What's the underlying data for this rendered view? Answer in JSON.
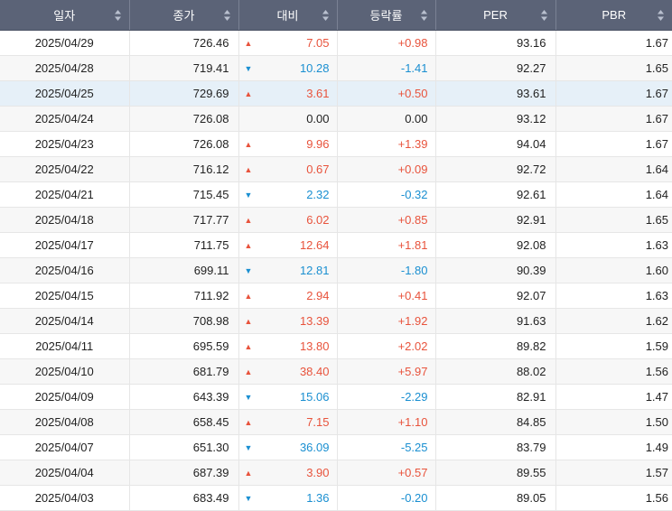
{
  "headers": {
    "date": "일자",
    "close": "종가",
    "diff": "대비",
    "rate": "등락률",
    "per": "PER",
    "pbr": "PBR"
  },
  "colors": {
    "up": "#e8533c",
    "down": "#1a8fd1",
    "header_bg": "#5b6377",
    "highlight_row": "#e6f0f8"
  },
  "icons": {
    "sort": "sort-updown-icon",
    "up": "triangle-up-icon",
    "down": "triangle-down-icon"
  },
  "highlighted_row": 2,
  "rows": [
    {
      "date": "2025/04/29",
      "close": "726.46",
      "dir": "up",
      "diff": "7.05",
      "rate": "+0.98",
      "per": "93.16",
      "pbr": "1.67"
    },
    {
      "date": "2025/04/28",
      "close": "719.41",
      "dir": "down",
      "diff": "10.28",
      "rate": "-1.41",
      "per": "92.27",
      "pbr": "1.65"
    },
    {
      "date": "2025/04/25",
      "close": "729.69",
      "dir": "up",
      "diff": "3.61",
      "rate": "+0.50",
      "per": "93.61",
      "pbr": "1.67"
    },
    {
      "date": "2025/04/24",
      "close": "726.08",
      "dir": "flat",
      "diff": "0.00",
      "rate": "0.00",
      "per": "93.12",
      "pbr": "1.67"
    },
    {
      "date": "2025/04/23",
      "close": "726.08",
      "dir": "up",
      "diff": "9.96",
      "rate": "+1.39",
      "per": "94.04",
      "pbr": "1.67"
    },
    {
      "date": "2025/04/22",
      "close": "716.12",
      "dir": "up",
      "diff": "0.67",
      "rate": "+0.09",
      "per": "92.72",
      "pbr": "1.64"
    },
    {
      "date": "2025/04/21",
      "close": "715.45",
      "dir": "down",
      "diff": "2.32",
      "rate": "-0.32",
      "per": "92.61",
      "pbr": "1.64"
    },
    {
      "date": "2025/04/18",
      "close": "717.77",
      "dir": "up",
      "diff": "6.02",
      "rate": "+0.85",
      "per": "92.91",
      "pbr": "1.65"
    },
    {
      "date": "2025/04/17",
      "close": "711.75",
      "dir": "up",
      "diff": "12.64",
      "rate": "+1.81",
      "per": "92.08",
      "pbr": "1.63"
    },
    {
      "date": "2025/04/16",
      "close": "699.11",
      "dir": "down",
      "diff": "12.81",
      "rate": "-1.80",
      "per": "90.39",
      "pbr": "1.60"
    },
    {
      "date": "2025/04/15",
      "close": "711.92",
      "dir": "up",
      "diff": "2.94",
      "rate": "+0.41",
      "per": "92.07",
      "pbr": "1.63"
    },
    {
      "date": "2025/04/14",
      "close": "708.98",
      "dir": "up",
      "diff": "13.39",
      "rate": "+1.92",
      "per": "91.63",
      "pbr": "1.62"
    },
    {
      "date": "2025/04/11",
      "close": "695.59",
      "dir": "up",
      "diff": "13.80",
      "rate": "+2.02",
      "per": "89.82",
      "pbr": "1.59"
    },
    {
      "date": "2025/04/10",
      "close": "681.79",
      "dir": "up",
      "diff": "38.40",
      "rate": "+5.97",
      "per": "88.02",
      "pbr": "1.56"
    },
    {
      "date": "2025/04/09",
      "close": "643.39",
      "dir": "down",
      "diff": "15.06",
      "rate": "-2.29",
      "per": "82.91",
      "pbr": "1.47"
    },
    {
      "date": "2025/04/08",
      "close": "658.45",
      "dir": "up",
      "diff": "7.15",
      "rate": "+1.10",
      "per": "84.85",
      "pbr": "1.50"
    },
    {
      "date": "2025/04/07",
      "close": "651.30",
      "dir": "down",
      "diff": "36.09",
      "rate": "-5.25",
      "per": "83.79",
      "pbr": "1.49"
    },
    {
      "date": "2025/04/04",
      "close": "687.39",
      "dir": "up",
      "diff": "3.90",
      "rate": "+0.57",
      "per": "89.55",
      "pbr": "1.57"
    },
    {
      "date": "2025/04/03",
      "close": "683.49",
      "dir": "down",
      "diff": "1.36",
      "rate": "-0.20",
      "per": "89.05",
      "pbr": "1.56"
    }
  ]
}
